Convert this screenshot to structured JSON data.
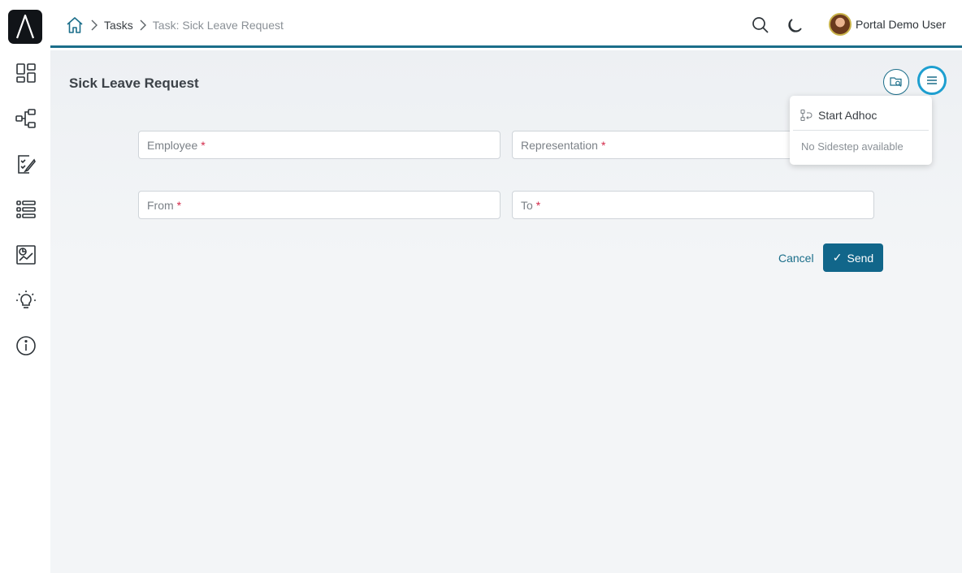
{
  "header": {
    "breadcrumb": {
      "home_icon": "home-icon",
      "items": [
        {
          "label": "Tasks"
        },
        {
          "label": "Task: Sick Leave Request"
        }
      ]
    },
    "user": {
      "name": "Portal Demo User"
    }
  },
  "sidebar": {
    "items": [
      {
        "icon": "dashboard-icon"
      },
      {
        "icon": "process-icon"
      },
      {
        "icon": "tasks-icon"
      },
      {
        "icon": "list-icon"
      },
      {
        "icon": "statistics-icon"
      },
      {
        "icon": "lightbulb-icon"
      },
      {
        "icon": "info-icon"
      }
    ]
  },
  "main": {
    "title": "Sick Leave Request",
    "form": {
      "employee_label": "Employee",
      "representation_label": "Representation",
      "from_label": "From",
      "to_label": "To",
      "required_mark": "*"
    },
    "actions": {
      "cancel_label": "Cancel",
      "send_label": "Send",
      "send_icon": "✓"
    },
    "menu": {
      "start_adhoc_label": "Start Adhoc",
      "no_sidestep_label": "No Sidestep available"
    }
  },
  "colors": {
    "accent": "#1b6e8a",
    "primary_button": "#11668a",
    "required": "#d32a4a",
    "active_ring": "#1e9fd0"
  }
}
